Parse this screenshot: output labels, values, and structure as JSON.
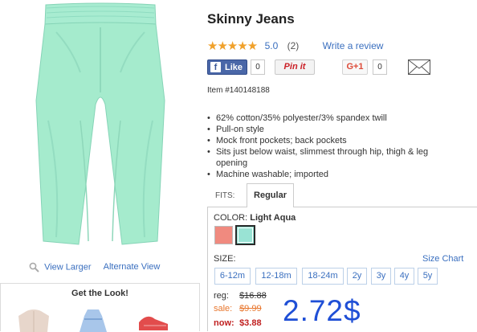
{
  "product": {
    "title": "Skinny Jeans",
    "rating_stars": "★★★★★",
    "rating_value": "5.0",
    "review_count": "(2)",
    "write_review": "Write a review",
    "item_number": "Item #140148188",
    "image_icon": "mint-skinny-jeans",
    "image_color": "#a5ebcd"
  },
  "image_links": {
    "view_larger": "View Larger",
    "alternate_view": "Alternate View"
  },
  "get_the_look": {
    "title": "Get the Look!"
  },
  "social": {
    "fb_icon": "f",
    "fb_like": "Like",
    "fb_count": "0",
    "pinterest": "Pin it",
    "pin_count": "0",
    "gplus": "G+1",
    "gplus_count": "0"
  },
  "features": [
    "62% cotton/35% polyester/3% spandex twill",
    "Pull-on style",
    "Mock front pockets; back pockets",
    "Sits just below waist, slimmest through hip, thigh & leg opening",
    "Machine washable; imported"
  ],
  "fits": {
    "label": "FITS:",
    "selected": "Regular"
  },
  "color": {
    "label": "COLOR:",
    "selected": "Light Aqua",
    "swatches": [
      "#f08a7f",
      "#99e3d4"
    ]
  },
  "size": {
    "label": "SIZE:",
    "chart_link": "Size Chart",
    "options": [
      "6-12m",
      "12-18m",
      "18-24m",
      "2y",
      "3y",
      "4y",
      "5y"
    ]
  },
  "price": {
    "reg_label": "reg:",
    "reg_value": "$16.88",
    "sale_label": "sale:",
    "sale_value": "$9.99",
    "now_label": "now:",
    "now_value": "$3.88",
    "overlay": "2.72$"
  },
  "colors": {
    "link": "#3a6fbf",
    "star": "#f0a12b",
    "sale": "#e8762d",
    "now": "#c02020",
    "overlay": "#1f4fd6"
  }
}
